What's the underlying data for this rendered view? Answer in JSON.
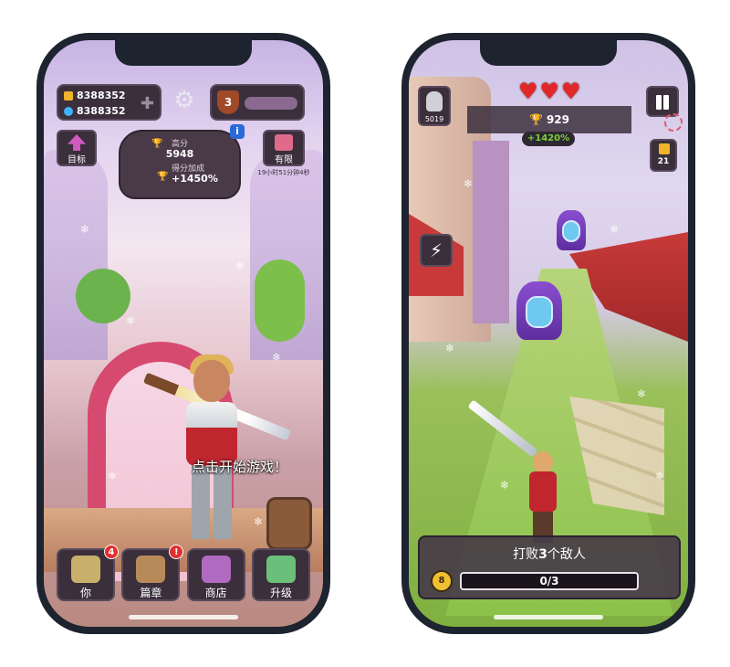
{
  "left_screen": {
    "coins": "8388352",
    "gems": "8388352",
    "level": "3",
    "goal_label": "目标",
    "limited_label": "有限",
    "limited_timer": "19小时51分钟4秒",
    "high_score_label": "高分",
    "high_score_value": "5948",
    "score_bonus_label": "得分加成",
    "score_bonus_value": "+1450%",
    "info_badge": "i",
    "tap_to_start": "点击开始游戏！",
    "nav": [
      {
        "label": "你",
        "badge": "4",
        "icon": "hero-icon",
        "color": "#c8b06a"
      },
      {
        "label": "篇章",
        "badge": "!",
        "icon": "chapter-icon",
        "color": "#b88a5a"
      },
      {
        "label": "商店",
        "badge": "",
        "icon": "shop-icon",
        "color": "#b06ac0"
      },
      {
        "label": "升级",
        "badge": "",
        "icon": "upgrade-icon",
        "color": "#6ac07a"
      }
    ]
  },
  "right_screen": {
    "armor_value": "5019",
    "lives": 3,
    "score_value": "929",
    "bonus_value": "+1420%",
    "coin_pickup_count": "21",
    "mission_title_prefix": "打败",
    "mission_title_number": "3",
    "mission_title_suffix": "个敌人",
    "mission_progress_text": "0/3",
    "mission_progress": 0,
    "mission_icon": "8"
  },
  "colors": {
    "panel": "#3a2f3b",
    "accent_green": "#7ccf3a",
    "heart_red": "#e02828",
    "badge_red": "#e03030"
  }
}
